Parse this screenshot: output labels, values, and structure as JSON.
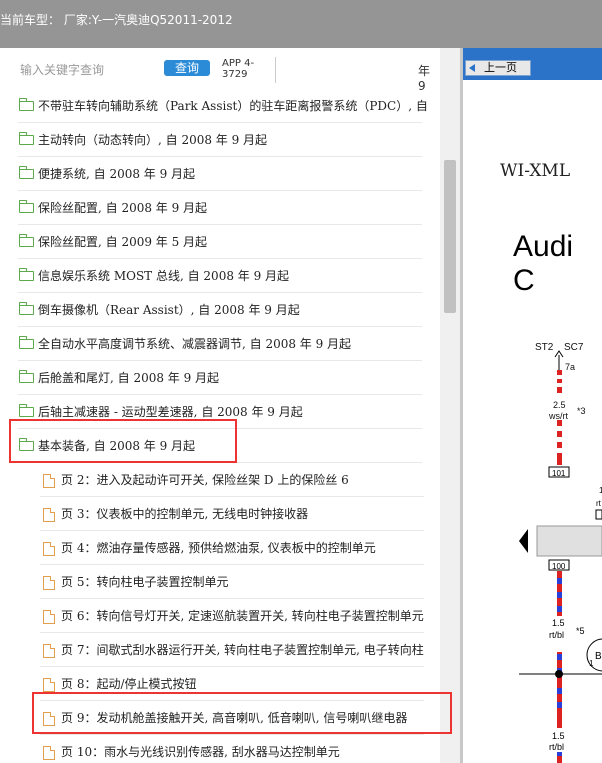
{
  "topbar": {
    "title": "当前车型：  厂家:Y-一汽奥迪Q52011-2012"
  },
  "search": {
    "placeholder": "输入关键字查询",
    "button": "查询",
    "version_line1": "APP 4-",
    "version_line2": "3729",
    "cut_text": "年 9"
  },
  "tree": [
    {
      "type": "folder",
      "label": "不带驻车转向辅助系统（Park Assist）的驻车距离报警系统（PDC）, 自"
    },
    {
      "type": "folder",
      "label": "主动转向（动态转向）, 自 2008 年 9 月起"
    },
    {
      "type": "folder",
      "label": "便捷系统, 自 2008 年 9 月起"
    },
    {
      "type": "folder",
      "label": "保险丝配置, 自 2008 年 9 月起"
    },
    {
      "type": "folder",
      "label": "保险丝配置, 自 2009 年 5 月起"
    },
    {
      "type": "folder",
      "label": "信息娱乐系统 MOST 总线, 自 2008 年 9 月起"
    },
    {
      "type": "folder",
      "label": "倒车摄像机（Rear Assist）, 自 2008 年 9 月起"
    },
    {
      "type": "folder",
      "label": "全自动水平高度调节系统、减震器调节, 自 2008 年 9 月起"
    },
    {
      "type": "folder",
      "label": "后舱盖和尾灯, 自 2008 年 9 月起"
    },
    {
      "type": "folder",
      "label": "后轴主减速器 - 运动型差速器, 自 2008 年 9 月起"
    },
    {
      "type": "folder",
      "label": "基本装备, 自 2008 年 9 月起"
    },
    {
      "type": "page",
      "label": "页 2：进入及起动许可开关, 保险丝架 D 上的保险丝 6"
    },
    {
      "type": "page",
      "label": "页 3：仪表板中的控制单元, 无线电时钟接收器"
    },
    {
      "type": "page",
      "label": "页 4：燃油存量传感器, 预供给燃油泵, 仪表板中的控制单元"
    },
    {
      "type": "page",
      "label": "页 5：转向柱电子装置控制单元"
    },
    {
      "type": "page",
      "label": "页 6：转向信号灯开关, 定速巡航装置开关, 转向柱电子装置控制单元"
    },
    {
      "type": "page",
      "label": "页 7：间歇式刮水器运行开关, 转向柱电子装置控制单元, 电子转向柱"
    },
    {
      "type": "page",
      "label": "页 8：起动/停止模式按钮"
    },
    {
      "type": "page",
      "label": "页 9：发动机舱盖接触开关, 高音喇叭, 低音喇叭, 信号喇叭继电器"
    },
    {
      "type": "page",
      "label": "页 10：雨水与光线识别传感器, 刮水器马达控制单元"
    }
  ],
  "viewer": {
    "prev_button": "上一页",
    "header_text": "WI-XML",
    "title_fragment": "Audi C",
    "labels": {
      "st2": "ST2",
      "sc7": "SC7",
      "pin7a": "7a",
      "w25": "2.5",
      "wsrt": "ws/rt",
      "n3": "*3",
      "box101": "101",
      "box100": "100",
      "w15a": "1.5",
      "rtbl": "rt/bl",
      "n5": "*5",
      "w15b": "1.5",
      "rtbl2": "rt/bl",
      "b": "B",
      "num1": "1",
      "rt": "rt",
      "num1b": "1"
    }
  }
}
